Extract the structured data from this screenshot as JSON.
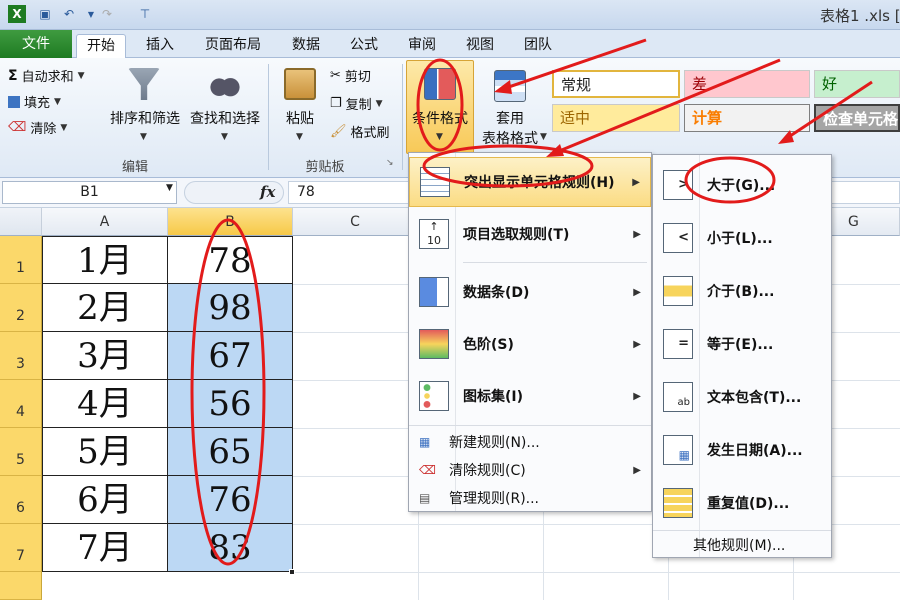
{
  "window": {
    "title": "表格1 .xls ["
  },
  "tabs": [
    {
      "label": "文件"
    },
    {
      "label": "开始"
    },
    {
      "label": "插入"
    },
    {
      "label": "页面布局"
    },
    {
      "label": "数据"
    },
    {
      "label": "公式"
    },
    {
      "label": "审阅"
    },
    {
      "label": "视图"
    },
    {
      "label": "团队"
    }
  ],
  "ribbon": {
    "editing": {
      "autosum": "自动求和",
      "fill": "填充",
      "clear": "清除",
      "sort_filter": "排序和筛选",
      "find_select": "查找和选择",
      "group_label": "编辑"
    },
    "clipboard": {
      "paste": "粘贴",
      "cut": "剪切",
      "copy": "复制",
      "format_painter": "格式刷",
      "group_label": "剪贴板"
    },
    "conditional_format": "条件格式",
    "table_format": {
      "line1": "套用",
      "line2": "表格格式"
    },
    "styles": [
      {
        "label": "常规",
        "bg": "#ffffff",
        "fg": "#000000"
      },
      {
        "label": "差",
        "bg": "#ffc7ce",
        "fg": "#9c0006"
      },
      {
        "label": "好",
        "bg": "#c6efce",
        "fg": "#006100"
      },
      {
        "label": "适中",
        "bg": "#ffeb9c",
        "fg": "#9c6500"
      },
      {
        "label": "计算",
        "bg": "#f2f2f2",
        "fg": "#fa7d00"
      },
      {
        "label": "检查单元格",
        "bg": "#a5a5a5",
        "fg": "#ffffff"
      }
    ]
  },
  "formula_bar": {
    "name_box": "B1",
    "fx": "fx",
    "value": "78"
  },
  "columns": [
    "A",
    "B",
    "C",
    "G"
  ],
  "rows": [
    {
      "num": "1",
      "a": "1月",
      "b": "78"
    },
    {
      "num": "2",
      "a": "2月",
      "b": "98"
    },
    {
      "num": "3",
      "a": "3月",
      "b": "67"
    },
    {
      "num": "4",
      "a": "4月",
      "b": "56"
    },
    {
      "num": "5",
      "a": "5月",
      "b": "65"
    },
    {
      "num": "6",
      "a": "6月",
      "b": "76"
    },
    {
      "num": "7",
      "a": "7月",
      "b": "83"
    }
  ],
  "cf_menu": {
    "items": [
      {
        "label": "突出显示单元格规则(H)"
      },
      {
        "label": "项目选取规则(T)"
      },
      {
        "label": "数据条(D)"
      },
      {
        "label": "色阶(S)"
      },
      {
        "label": "图标集(I)"
      }
    ],
    "actions": [
      {
        "label": "新建规则(N)..."
      },
      {
        "label": "清除规则(C)"
      },
      {
        "label": "管理规则(R)..."
      }
    ]
  },
  "highlight_menu": {
    "items": [
      {
        "label": "大于(G)..."
      },
      {
        "label": "小于(L)..."
      },
      {
        "label": "介于(B)..."
      },
      {
        "label": "等于(E)..."
      },
      {
        "label": "文本包含(T)..."
      },
      {
        "label": "发生日期(A)..."
      },
      {
        "label": "重复值(D)..."
      }
    ],
    "more": "其他规则(M)..."
  },
  "colors": {
    "annotation": "#e21b1b",
    "selection": "#bcd8f4",
    "row_header": "#fbd86a",
    "file_tab": "#2a8a2e"
  }
}
